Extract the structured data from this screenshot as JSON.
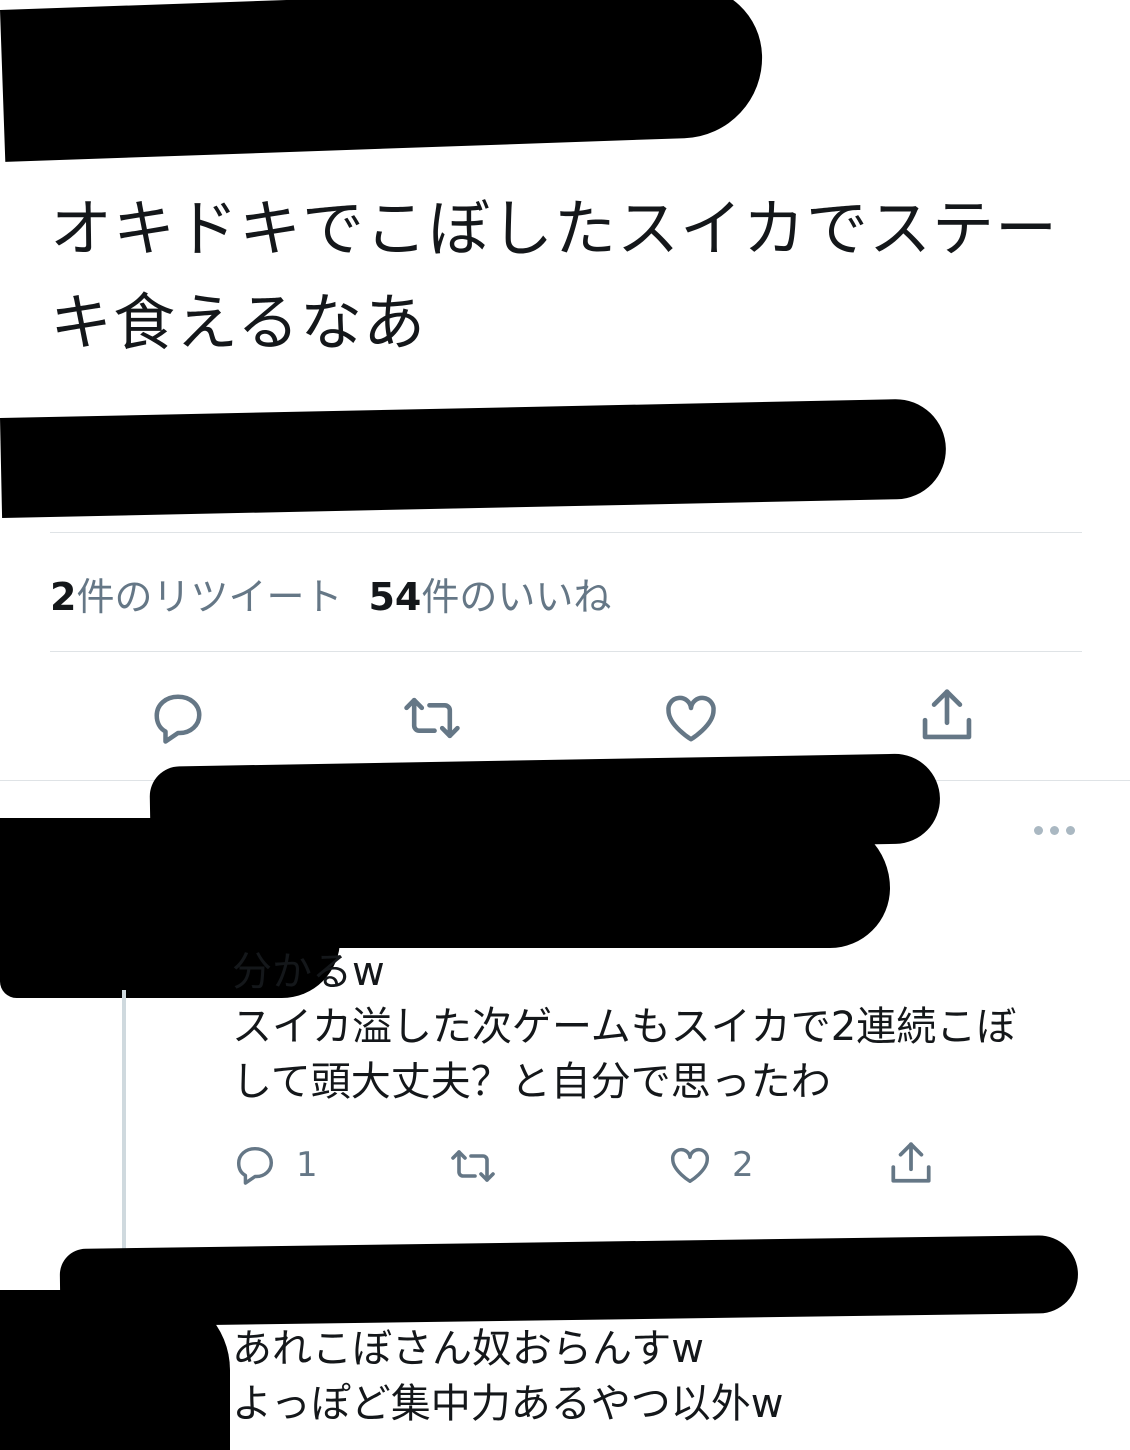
{
  "tweet": {
    "text_lines": [
      "オキドキでこぼしたスイカでステー",
      "キ食えるなあ"
    ],
    "retweet_count": "2",
    "retweet_label": "件のリツイート",
    "like_count": "54",
    "like_label": "件のいいね"
  },
  "replies": [
    {
      "lines": [
        "分かるw",
        "スイカ溢した次ゲームもスイカで2連続こぼ",
        "して頭大丈夫？と自分で思ったわ"
      ],
      "reply_count": "1",
      "like_count": "2"
    },
    {
      "lines": [
        "あれこぼさん奴おらんすw",
        "よっぽど集中力あるやつ以外w"
      ]
    }
  ],
  "colors": {
    "text": "#14171a",
    "secondary": "#657786",
    "divider": "#dfe3e6",
    "redaction": "#000000"
  },
  "icons": [
    "reply-icon",
    "retweet-icon",
    "like-icon",
    "share-icon",
    "more-icon"
  ]
}
